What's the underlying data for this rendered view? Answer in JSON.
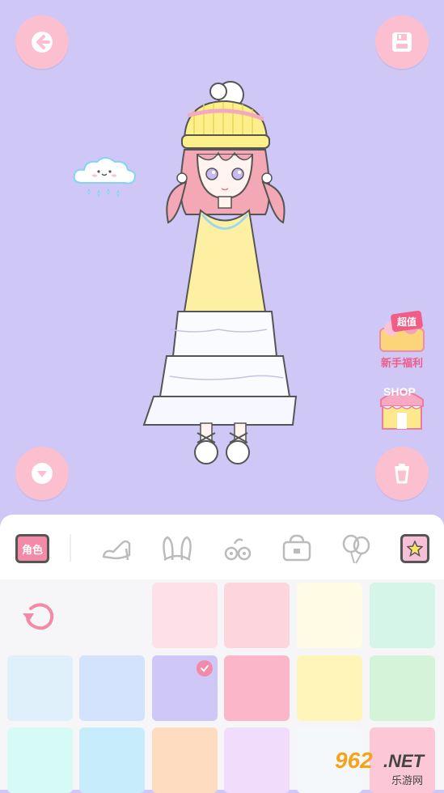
{
  "side": {
    "welfare_badge_top": "超值",
    "welfare_label": "新手福利",
    "shop_label": "SHOP"
  },
  "tabs": {
    "role_label": "角色",
    "icons": [
      "shoe-icon",
      "bunny-ears-icon",
      "flower-hairpin-icon",
      "bag-icon",
      "balloon-icon",
      "star-icon"
    ]
  },
  "swatches": [
    {
      "color": "#fde0e8",
      "selected": false
    },
    {
      "color": "#fdd5dd",
      "selected": false
    },
    {
      "color": "#fffbe4",
      "selected": false
    },
    {
      "color": "#d5f5e8",
      "selected": false
    },
    {
      "color": "#dff0fb",
      "selected": false
    },
    {
      "color": "#d4e3fd",
      "selected": false
    },
    {
      "color": "#cfc7f5",
      "selected": true
    },
    {
      "color": "#fcb6ca",
      "selected": false
    },
    {
      "color": "#fff5b8",
      "selected": false
    },
    {
      "color": "#d5f3d9",
      "selected": false
    },
    {
      "color": "#d6fbf6",
      "selected": false
    },
    {
      "color": "#c7ecfc",
      "selected": false
    },
    {
      "color": "#fddcc0",
      "selected": false
    },
    {
      "color": "#f1dcfb",
      "selected": false
    },
    {
      "color": "#f4f8fb",
      "selected": false
    },
    {
      "color": "#fcc8d8",
      "selected": false
    }
  ],
  "watermark": {
    "num": "962",
    "net": ".NET",
    "cn": "乐游网"
  }
}
